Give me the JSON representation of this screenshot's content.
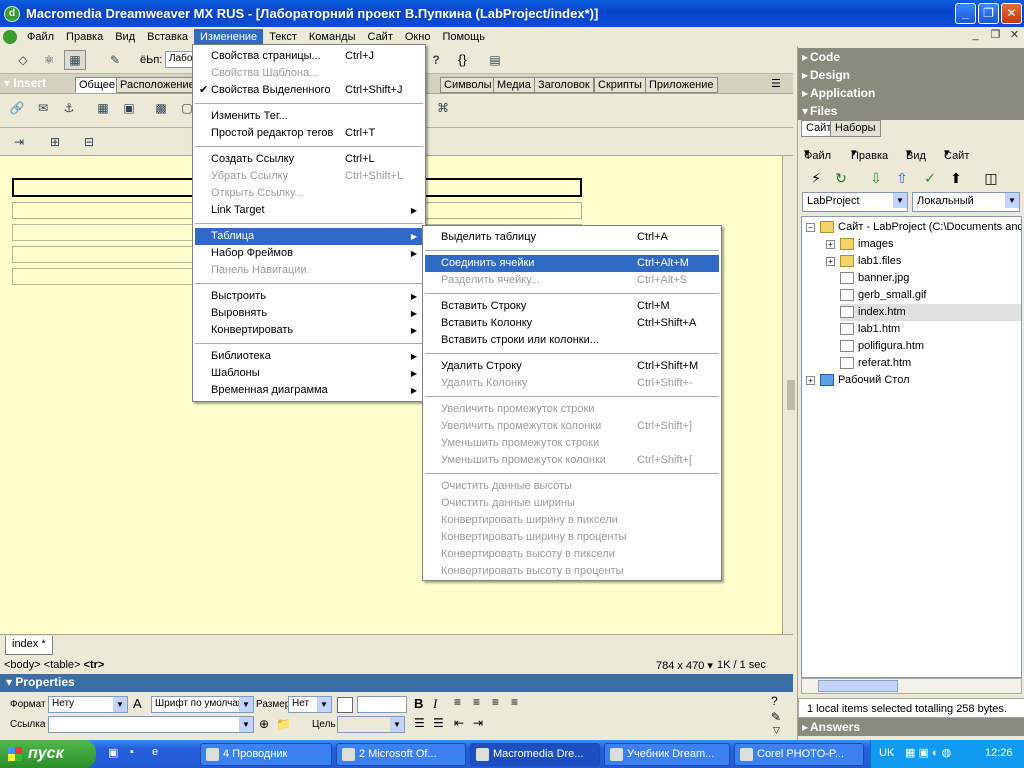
{
  "window": {
    "title": "Macromedia Dreamweaver MX RUS - [Лабораторний проект В.Пупкина (LabProject/index*)]",
    "app_icon": "dreamweaver-icon"
  },
  "menubar": {
    "items": [
      "Файл",
      "Правка",
      "Вид",
      "Вставка",
      "Изменение",
      "Текст",
      "Команды",
      "Сайт",
      "Окно",
      "Помощь"
    ],
    "active": "Изменение"
  },
  "toolbar": {
    "title_label": "ёЬп:",
    "title_value": "Лабо",
    "brace_label": "{}"
  },
  "insert": {
    "title": "Insert",
    "tabs": [
      "Общее",
      "Расположение",
      "Символы",
      "Медиа",
      "Заголовок",
      "Скрипты",
      "Приложение"
    ],
    "selected": "Общее"
  },
  "document": {
    "tab_label": "index *",
    "tag_path": [
      "<body>",
      "<table>",
      "<tr>"
    ],
    "window_size": "784 x 470",
    "download_info": "1K / 1 sec"
  },
  "properties": {
    "title": "Properties",
    "format_label": "Формат",
    "format_value": "Нету",
    "font_value": "Шрифт по умолчан",
    "size_label": "Размер:",
    "size_value": "Нет",
    "link_label": "Ссылка",
    "target_label": "Цель",
    "bold": "B",
    "italic": "I"
  },
  "modify_menu": {
    "items": [
      {
        "label": "Свойства страницы...",
        "shortcut": "Ctrl+J"
      },
      {
        "label": "Свойства Шаблона...",
        "shortcut": "",
        "disabled": true
      },
      {
        "label": "Свойства Выделенного",
        "shortcut": "Ctrl+Shift+J",
        "checked": true
      },
      {
        "sep": true
      },
      {
        "label": "Изменить Тег...",
        "shortcut": ""
      },
      {
        "label": "Простой редактор тегов",
        "shortcut": "Ctrl+T"
      },
      {
        "sep": true
      },
      {
        "label": "Создать Ссылку",
        "shortcut": "Ctrl+L"
      },
      {
        "label": "Убрать Ссылку",
        "shortcut": "Ctrl+Shift+L",
        "disabled": true
      },
      {
        "label": "Открыть Ссылку...",
        "shortcut": "",
        "disabled": true
      },
      {
        "label": "Link Target",
        "submenu": true
      },
      {
        "sep": true
      },
      {
        "label": "Таблица",
        "submenu": true,
        "highlight": true
      },
      {
        "label": "Набор Фреймов",
        "submenu": true
      },
      {
        "label": "Панель Навигации",
        "disabled": true
      },
      {
        "sep": true
      },
      {
        "label": "Выстроить",
        "submenu": true
      },
      {
        "label": "Выровнять",
        "submenu": true
      },
      {
        "label": "Конвертировать",
        "submenu": true
      },
      {
        "sep": true
      },
      {
        "label": "Библиотека",
        "submenu": true
      },
      {
        "label": "Шаблоны",
        "submenu": true
      },
      {
        "label": "Временная диаграмма",
        "submenu": true
      }
    ]
  },
  "table_menu": {
    "items": [
      {
        "label": "Выделить таблицу",
        "shortcut": "Ctrl+A"
      },
      {
        "sep": true
      },
      {
        "label": "Соединить ячейки",
        "shortcut": "Ctrl+Alt+M",
        "highlight": true
      },
      {
        "label": "Разделить ячейку...",
        "shortcut": "Ctrl+Alt+S",
        "disabled": true
      },
      {
        "sep": true
      },
      {
        "label": "Вставить Строку",
        "shortcut": "Ctrl+M"
      },
      {
        "label": "Вставить Колонку",
        "shortcut": "Ctrl+Shift+A"
      },
      {
        "label": "Вставить строки или колонки...",
        "shortcut": ""
      },
      {
        "sep": true
      },
      {
        "label": "Удалить Строку",
        "shortcut": "Ctrl+Shift+M"
      },
      {
        "label": "Удалить Колонку",
        "shortcut": "Ctrl+Shift+-",
        "disabled": true
      },
      {
        "sep": true
      },
      {
        "label": "Увеличить промежуток строки",
        "shortcut": "",
        "disabled": true
      },
      {
        "label": "Увеличить промежуток колонки",
        "shortcut": "Ctrl+Shift+]",
        "disabled": true
      },
      {
        "label": "Уменьшить промежуток строки",
        "shortcut": "",
        "disabled": true
      },
      {
        "label": "Уменьшить промежуток колонки",
        "shortcut": "Ctrl+Shift+[",
        "disabled": true
      },
      {
        "sep": true
      },
      {
        "label": "Очистить данные высоты",
        "shortcut": "",
        "disabled": true
      },
      {
        "label": "Очистить данные ширины",
        "shortcut": "",
        "disabled": true
      },
      {
        "label": "Конвертировать ширину в пиксели",
        "shortcut": "",
        "disabled": true
      },
      {
        "label": "Конвертировать ширину в проценты",
        "shortcut": "",
        "disabled": true
      },
      {
        "label": "Конвертировать высоту в пиксели",
        "shortcut": "",
        "disabled": true
      },
      {
        "label": "Конвертировать высоту в проценты",
        "shortcut": "",
        "disabled": true
      }
    ]
  },
  "right_panel": {
    "sections": [
      "Code",
      "Design",
      "Application",
      "Files"
    ],
    "file_tabs": [
      "Сайт",
      "Наборы"
    ],
    "file_menu": [
      "Файл",
      "Правка",
      "Вид",
      "Сайт"
    ],
    "site_select": "LabProject",
    "view_select": "Локальный",
    "tree": [
      {
        "label": "Сайт - LabProject (C:\\Documents and",
        "type": "folder",
        "level": 0,
        "expander": "−"
      },
      {
        "label": "images",
        "type": "folder",
        "level": 1,
        "expander": "+"
      },
      {
        "label": "lab1.files",
        "type": "folder",
        "level": 1,
        "expander": "+"
      },
      {
        "label": "banner.jpg",
        "type": "file",
        "level": 1
      },
      {
        "label": "gerb_small.gif",
        "type": "file",
        "level": 1
      },
      {
        "label": "index.htm",
        "type": "file",
        "level": 1,
        "selected": true
      },
      {
        "label": "lab1.htm",
        "type": "file",
        "level": 1
      },
      {
        "label": "polifigura.htm",
        "type": "file",
        "level": 1
      },
      {
        "label": "referat.htm",
        "type": "file",
        "level": 1
      },
      {
        "label": "Рабочий Стол",
        "type": "desktop",
        "level": 0,
        "expander": "+"
      }
    ],
    "status": "1 local items selected totalling 258 bytes.",
    "answers": "Answers"
  },
  "taskbar": {
    "start": "пуск",
    "tasks": [
      {
        "label": "4 Проводник"
      },
      {
        "label": "2 Microsoft Of..."
      },
      {
        "label": "Macromedia Dre...",
        "active": true
      },
      {
        "label": "Учебник Dream..."
      },
      {
        "label": "Corel PHOTO-P..."
      }
    ],
    "lang": "UK",
    "clock": "12:26"
  }
}
